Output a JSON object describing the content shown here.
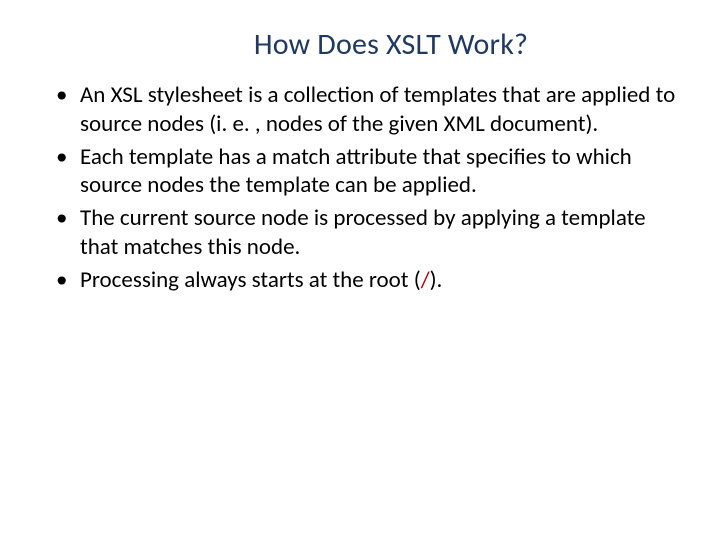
{
  "slide": {
    "title": "How Does XSLT Work?",
    "bullets": [
      {
        "text": "An XSL stylesheet is a collection of templates that are applied to source nodes (i. e. , nodes of the given XML document)."
      },
      {
        "text": "Each template has a match attribute that specifies to which source nodes the template can be applied."
      },
      {
        "text": "The current source node is processed by applying a template that matches this node."
      },
      {
        "prefix": "Processing always starts at the root (",
        "accent": "/",
        "suffix": ")."
      }
    ]
  }
}
